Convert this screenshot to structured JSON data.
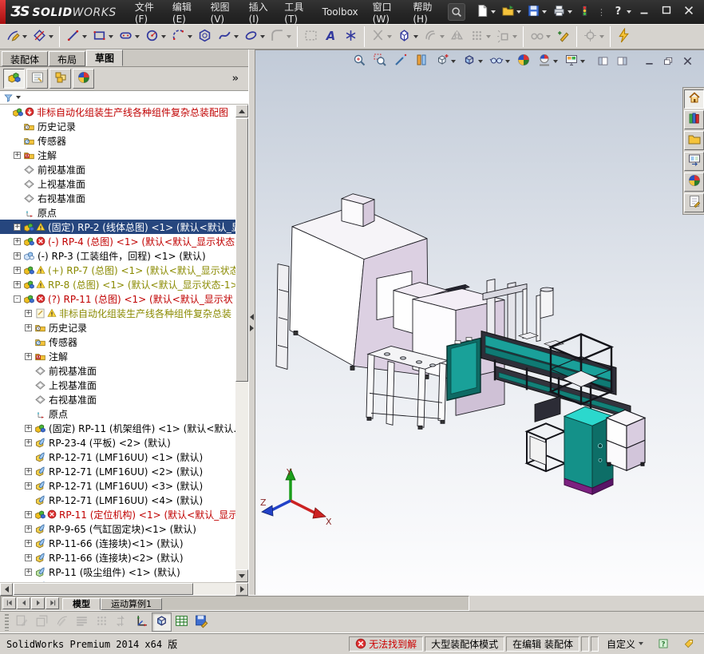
{
  "titlebar": {
    "logo": {
      "mark": "ƷS",
      "name_bold": "SOLID",
      "name_light": "WORKS"
    },
    "menus": [
      {
        "label": "文件(F)"
      },
      {
        "label": "编辑(E)"
      },
      {
        "label": "视图(V)"
      },
      {
        "label": "插入(I)"
      },
      {
        "label": "工具(T)"
      },
      {
        "label": "Toolbox"
      },
      {
        "label": "窗口(W)"
      },
      {
        "label": "帮助(H)"
      }
    ],
    "quick_icons": [
      {
        "icon": "qnew",
        "name": "new-document",
        "drop": true
      },
      {
        "icon": "qopen",
        "name": "open-document",
        "drop": true
      },
      {
        "icon": "qsave",
        "name": "save",
        "drop": true
      },
      {
        "icon": "qprint",
        "name": "print",
        "drop": true
      },
      {
        "icon": "qtraffic",
        "name": "rebuild-traffic-light"
      },
      {
        "dots": true
      },
      {
        "icon": "qhelp",
        "name": "help",
        "drop": true
      }
    ],
    "window_buttons": [
      {
        "icon": "w-min",
        "name": "minimize-window"
      },
      {
        "icon": "w-max",
        "name": "maximize-window"
      },
      {
        "icon": "w-close",
        "name": "close-window"
      }
    ]
  },
  "sketch_toolbar": [
    {
      "icon": "sk-sketch",
      "name": "sketch",
      "drop": true
    },
    {
      "icon": "sk-dim",
      "name": "smart-dimension",
      "drop": true
    },
    {
      "sep": true
    },
    {
      "icon": "sk-line",
      "name": "line",
      "drop": true
    },
    {
      "icon": "sk-rect",
      "name": "corner-rectangle",
      "drop": true
    },
    {
      "icon": "sk-slot",
      "name": "straight-slot",
      "drop": true
    },
    {
      "icon": "sk-circle",
      "name": "circle",
      "drop": true
    },
    {
      "icon": "sk-arc",
      "name": "perimeter-circle",
      "drop": true
    },
    {
      "icon": "sk-poly",
      "name": "polygon"
    },
    {
      "icon": "sk-spline",
      "name": "spline",
      "drop": true
    },
    {
      "icon": "sk-ellipse",
      "name": "ellipse",
      "drop": true
    },
    {
      "icon": "sk-fillet",
      "name": "sketch-fillet",
      "drop": true,
      "disabled": true
    },
    {
      "sep": true
    },
    {
      "icon": "sk-pattern",
      "name": "sketch-picture",
      "disabled": true
    },
    {
      "icon": "sk-text",
      "name": "sketch-text"
    },
    {
      "icon": "sk-point",
      "name": "point"
    },
    {
      "sep": true
    },
    {
      "icon": "sk-trim",
      "name": "trim-entities",
      "drop": true,
      "disabled": true
    },
    {
      "icon": "sk-convert",
      "name": "convert-entities",
      "drop": true
    },
    {
      "icon": "sk-offset",
      "name": "offset-entities",
      "drop": true,
      "disabled": true
    },
    {
      "icon": "sk-mirror",
      "name": "mirror-entities",
      "disabled": true
    },
    {
      "icon": "sk-grid",
      "name": "linear-sketch-pattern",
      "drop": true,
      "disabled": true
    },
    {
      "icon": "sk-move",
      "name": "move-entities",
      "drop": true,
      "disabled": true
    },
    {
      "sep": true
    },
    {
      "icon": "sk-rel",
      "name": "display-delete-relations",
      "drop": true,
      "disabled": true
    },
    {
      "icon": "sk-repair",
      "name": "repair-sketch"
    },
    {
      "sep": true
    },
    {
      "icon": "sk-snap",
      "name": "quick-snaps",
      "drop": true,
      "disabled": true
    },
    {
      "sep": true
    },
    {
      "icon": "sk-bolt",
      "name": "instant-3d"
    }
  ],
  "left_panel": {
    "tabs": [
      {
        "label": "装配体",
        "active": false
      },
      {
        "label": "布局",
        "active": false
      },
      {
        "label": "草图",
        "active": true
      }
    ],
    "fm_tabs": [
      {
        "icon": "fm-assembly",
        "name": "featuremanager-design-tree",
        "active": true
      },
      {
        "icon": "fm-property",
        "name": "property-manager"
      },
      {
        "icon": "fm-config",
        "name": "configuration-manager"
      },
      {
        "icon": "fm-display",
        "name": "display-manager"
      }
    ],
    "fm_overflow": "»",
    "tree": {
      "items": [
        {
          "l": 0,
          "i": "t-asm",
          "b": "b-rebuild",
          "t": "非标自动化组装生产线各种组件复杂总装配图",
          "c": "r"
        },
        {
          "l": 1,
          "i": "t-folder-clock",
          "t": "历史记录"
        },
        {
          "l": 1,
          "i": "t-folder-gauge",
          "t": "传感器"
        },
        {
          "l": 1,
          "e": "+",
          "i": "t-folder-a",
          "t": "注解"
        },
        {
          "l": 1,
          "i": "t-plane",
          "t": "前视基准面"
        },
        {
          "l": 1,
          "i": "t-plane",
          "t": "上视基准面"
        },
        {
          "l": 1,
          "i": "t-plane",
          "t": "右视基准面"
        },
        {
          "l": 1,
          "i": "t-origin",
          "t": "原点"
        },
        {
          "l": 1,
          "e": "+",
          "i": "t-asm",
          "b": "b-warn",
          "t": "(固定) RP-2 (线体总图) <1> (默认<默认_显",
          "s": true
        },
        {
          "l": 1,
          "e": "+",
          "i": "t-asm",
          "b": "b-err",
          "t": "(-) RP-4 (总图) <1> (默认<默认_显示状态",
          "c": "r"
        },
        {
          "l": 1,
          "e": "+",
          "i": "t-asm-blue",
          "t": "(-) RP-3 (工装组件，回程) <1> (默认)"
        },
        {
          "l": 1,
          "e": "+",
          "i": "t-asm",
          "b": "b-warn",
          "t": "(+) RP-7 (总图) <1> (默认<默认_显示状态-",
          "c": "o"
        },
        {
          "l": 1,
          "e": "+",
          "i": "t-asm",
          "b": "b-warn",
          "t": "RP-8 (总图) <1> (默认<默认_显示状态-1>)",
          "c": "o"
        },
        {
          "l": 1,
          "e": "-",
          "i": "t-asm",
          "b": "b-err",
          "t": "(?) RP-11 (总图) <1> (默认<默认_显示状",
          "c": "r"
        },
        {
          "l": 2,
          "e": "+",
          "i": "t-doc",
          "b": "b-warn",
          "t": "非标自动化组装生产线各种组件复杂总装",
          "c": "o"
        },
        {
          "l": 2,
          "e": "+",
          "i": "t-folder-clock",
          "t": "历史记录"
        },
        {
          "l": 2,
          "i": "t-folder-gauge",
          "t": "传感器"
        },
        {
          "l": 2,
          "e": "+",
          "i": "t-folder-a",
          "t": "注解"
        },
        {
          "l": 2,
          "i": "t-plane",
          "t": "前视基准面"
        },
        {
          "l": 2,
          "i": "t-plane",
          "t": "上视基准面"
        },
        {
          "l": 2,
          "i": "t-plane",
          "t": "右视基准面"
        },
        {
          "l": 2,
          "i": "t-origin",
          "t": "原点"
        },
        {
          "l": 2,
          "e": "+",
          "i": "t-asm",
          "t": "(固定) RP-11 (机架组件) <1> (默认<默认."
        },
        {
          "l": 2,
          "e": "+",
          "i": "t-part",
          "t": "RP-23-4 (平板) <2> (默认)"
        },
        {
          "l": 2,
          "i": "t-part",
          "t": "RP-12-71 (LMF16UU) <1> (默认)"
        },
        {
          "l": 2,
          "e": "+",
          "i": "t-part",
          "t": "RP-12-71 (LMF16UU) <2> (默认)"
        },
        {
          "l": 2,
          "e": "+",
          "i": "t-part",
          "t": "RP-12-71 (LMF16UU) <3> (默认)"
        },
        {
          "l": 2,
          "i": "t-part",
          "t": "RP-12-71 (LMF16UU) <4> (默认)"
        },
        {
          "l": 2,
          "e": "+",
          "i": "t-asm",
          "b": "b-err",
          "t": "RP-11 (定位机构) <1> (默认<默认_显示",
          "c": "r"
        },
        {
          "l": 2,
          "e": "+",
          "i": "t-part",
          "t": "RP-9-65 (气缸固定块)<1> (默认)"
        },
        {
          "l": 2,
          "e": "+",
          "i": "t-part",
          "t": "RP-11-66 (连接块)<1> (默认)"
        },
        {
          "l": 2,
          "e": "+",
          "i": "t-part",
          "t": "RP-11-66 (连接块)<2> (默认)"
        },
        {
          "l": 2,
          "e": "+",
          "i": "t-part-green",
          "t": "RP-11 (吸尘组件) <1> (默认)"
        },
        {
          "l": 2,
          "e": "+",
          "i": "t-part",
          "t": ""
        }
      ]
    }
  },
  "viewport": {
    "headsup": [
      {
        "icon": "h-zoomfit",
        "name": "zoom-to-fit"
      },
      {
        "icon": "h-zoomarea",
        "name": "zoom-to-area"
      },
      {
        "icon": "h-wand",
        "name": "magnified-selection"
      },
      {
        "icon": "h-section",
        "name": "section-view"
      },
      {
        "icon": "h-vcube",
        "name": "view-orientation",
        "drop": true
      },
      {
        "icon": "h-cube",
        "name": "display-style",
        "drop": true
      },
      {
        "icon": "h-glasses",
        "name": "hide-show-items",
        "drop": true
      },
      {
        "icon": "h-ball",
        "name": "edit-appearance"
      },
      {
        "icon": "h-scene",
        "name": "apply-scene",
        "drop": true
      },
      {
        "icon": "h-screen",
        "name": "view-settings",
        "drop": true
      }
    ],
    "doc_controls": [
      {
        "icon": "d-left",
        "name": "toggle-left-pane"
      },
      {
        "icon": "d-right",
        "name": "toggle-right-pane"
      },
      {
        "icon": "d-min",
        "name": "minimize-document"
      },
      {
        "icon": "d-restore",
        "name": "restore-document"
      },
      {
        "icon": "d-close",
        "name": "close-document"
      }
    ],
    "task_pane": [
      {
        "icon": "tp-home",
        "name": "solidworks-resources",
        "active": true
      },
      {
        "icon": "tp-lib",
        "name": "design-library"
      },
      {
        "icon": "tp-folder",
        "name": "file-explorer"
      },
      {
        "icon": "tp-palette",
        "name": "view-palette"
      },
      {
        "icon": "tp-ball",
        "name": "appearances-scenes"
      },
      {
        "icon": "tp-props",
        "name": "custom-properties"
      }
    ],
    "triad": {
      "x": "X",
      "y": "Y",
      "z": "Z"
    }
  },
  "bottom_tabs": {
    "nav": [
      {
        "icon": "nav-first",
        "name": "first-tab"
      },
      {
        "icon": "nav-prev",
        "name": "previous-tab"
      },
      {
        "icon": "nav-next",
        "name": "next-tab"
      },
      {
        "icon": "nav-last",
        "name": "last-tab"
      }
    ],
    "tabs": [
      {
        "label": "模型",
        "active": true
      },
      {
        "label": "运动算例1",
        "active": false
      }
    ]
  },
  "bottom_toolbar": [
    {
      "icon": "bb1",
      "name": "sketch-tool-1",
      "disabled": true
    },
    {
      "icon": "bb2",
      "name": "sketch-tool-2",
      "disabled": true
    },
    {
      "icon": "bb3",
      "name": "sketch-tool-3",
      "disabled": true
    },
    {
      "icon": "bb4",
      "name": "line-format",
      "disabled": true
    },
    {
      "icon": "bb5",
      "name": "grid-snap",
      "disabled": true
    },
    {
      "icon": "bb6",
      "name": "swap-entities",
      "disabled": true
    },
    {
      "icon": "bb-axes",
      "name": "reference-triad"
    },
    {
      "icon": "bb-cube",
      "name": "shaded-with-edges",
      "pressed": true
    },
    {
      "icon": "bb-table",
      "name": "design-table"
    },
    {
      "icon": "bb-save",
      "name": "save-table"
    }
  ],
  "statusbar": {
    "left": "SolidWorks Premium 2014 x64 版",
    "cells": [
      {
        "icon": "s-err",
        "label": "无法找到解",
        "color": "#cc0000",
        "name": "mate-solve-failure"
      },
      {
        "label": "大型装配体模式",
        "name": "large-assembly-mode"
      },
      {
        "label": "在编辑 装配体",
        "name": "editing-assembly"
      },
      {
        "label": " ",
        "name": "spacer-cell-1"
      },
      {
        "label": " ",
        "name": "spacer-cell-2"
      },
      {
        "label": "自定义",
        "drop": true,
        "flat": true,
        "name": "customize"
      },
      {
        "icon": "s-help",
        "flat": true,
        "name": "quick-tips"
      },
      {
        "icon": "s-tag",
        "flat": true,
        "name": "tags"
      }
    ]
  },
  "colors": {
    "titlebar": "#2b2b2b",
    "chrome": "#d6d3ce",
    "selection": "#26467e",
    "error_red": "#cc0000",
    "warning_olive": "#8a8a00",
    "teal": "#17948c",
    "cyan_top": "#2bd8cd",
    "lavender": "#d9ccdf",
    "purple_base": "#7c2180",
    "viewport_top": "#c2cbd8"
  }
}
